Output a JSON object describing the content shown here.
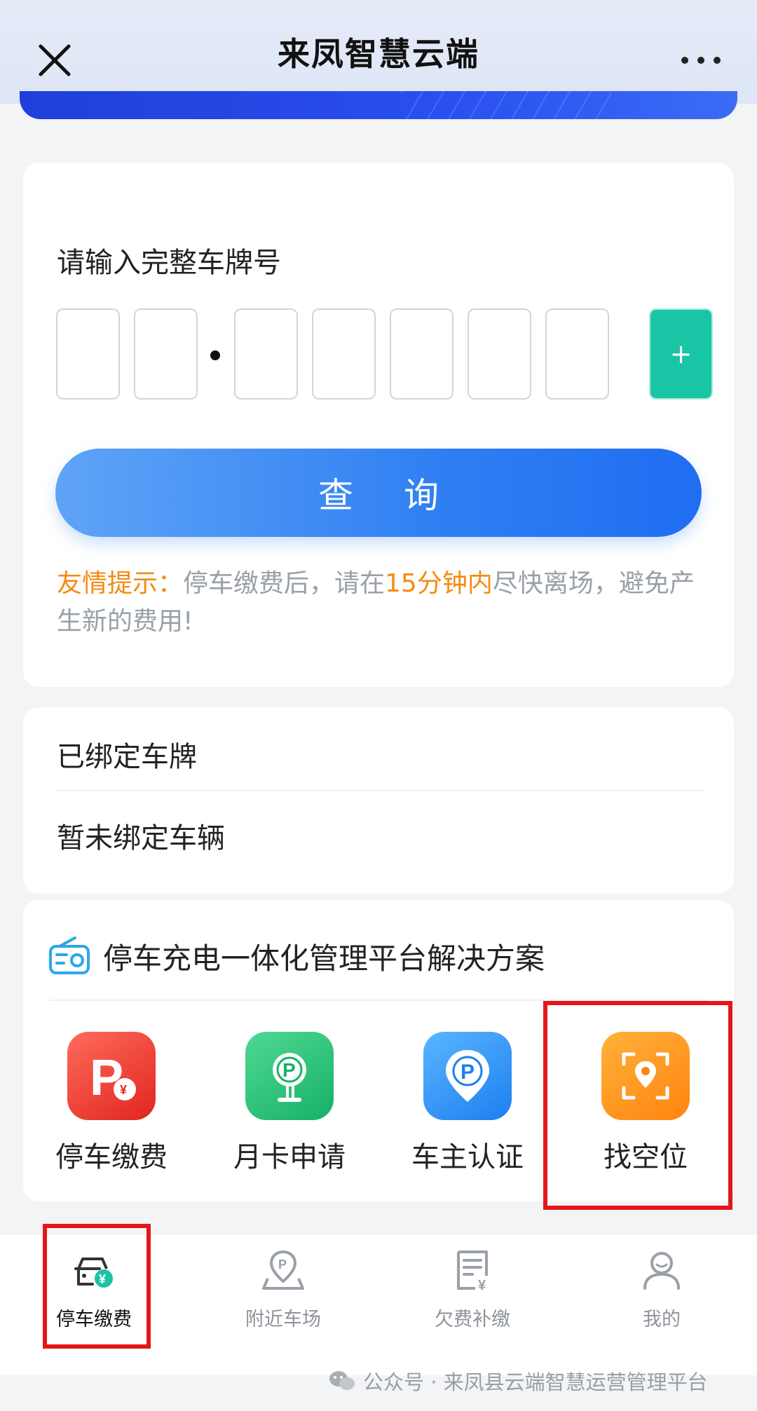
{
  "header": {
    "title": "来凤智慧云端"
  },
  "query_card": {
    "plate_label": "请输入完整车牌号",
    "plate_add_symbol": "+",
    "query_button": "查 询",
    "tip_prefix": "友情提示：",
    "tip_part1": "停车缴费后，请在",
    "tip_highlight": "15分钟内",
    "tip_part2": "尽快离场，避免产生新的费用!"
  },
  "bound_card": {
    "title": "已绑定车牌",
    "empty_text": "暂未绑定车辆"
  },
  "services": {
    "title": "停车充电一体化管理平台解决方案",
    "items": [
      {
        "label": "停车缴费",
        "icon": "parking-payment-icon",
        "color": "#ee3a34"
      },
      {
        "label": "月卡申请",
        "icon": "monthly-card-icon",
        "color": "#22c07a"
      },
      {
        "label": "车主认证",
        "icon": "owner-verify-icon",
        "color": "#2e8df5"
      },
      {
        "label": "找空位",
        "icon": "find-space-icon",
        "color": "#ff9318"
      }
    ]
  },
  "bottom_nav": {
    "items": [
      {
        "label": "停车缴费",
        "icon": "car-payment-icon",
        "active": true
      },
      {
        "label": "附近车场",
        "icon": "nearby-parking-icon",
        "active": false
      },
      {
        "label": "欠费补缴",
        "icon": "arrears-bill-icon",
        "active": false
      },
      {
        "label": "我的",
        "icon": "profile-icon",
        "active": false
      }
    ]
  },
  "watermark": {
    "text": "公众号 · 来凤县云端智慧运营管理平台"
  },
  "colors": {
    "accent_blue": "#2f7ff3",
    "teal": "#19c5a5",
    "orange": "#f58a12",
    "highlight_red": "#e5161a"
  }
}
